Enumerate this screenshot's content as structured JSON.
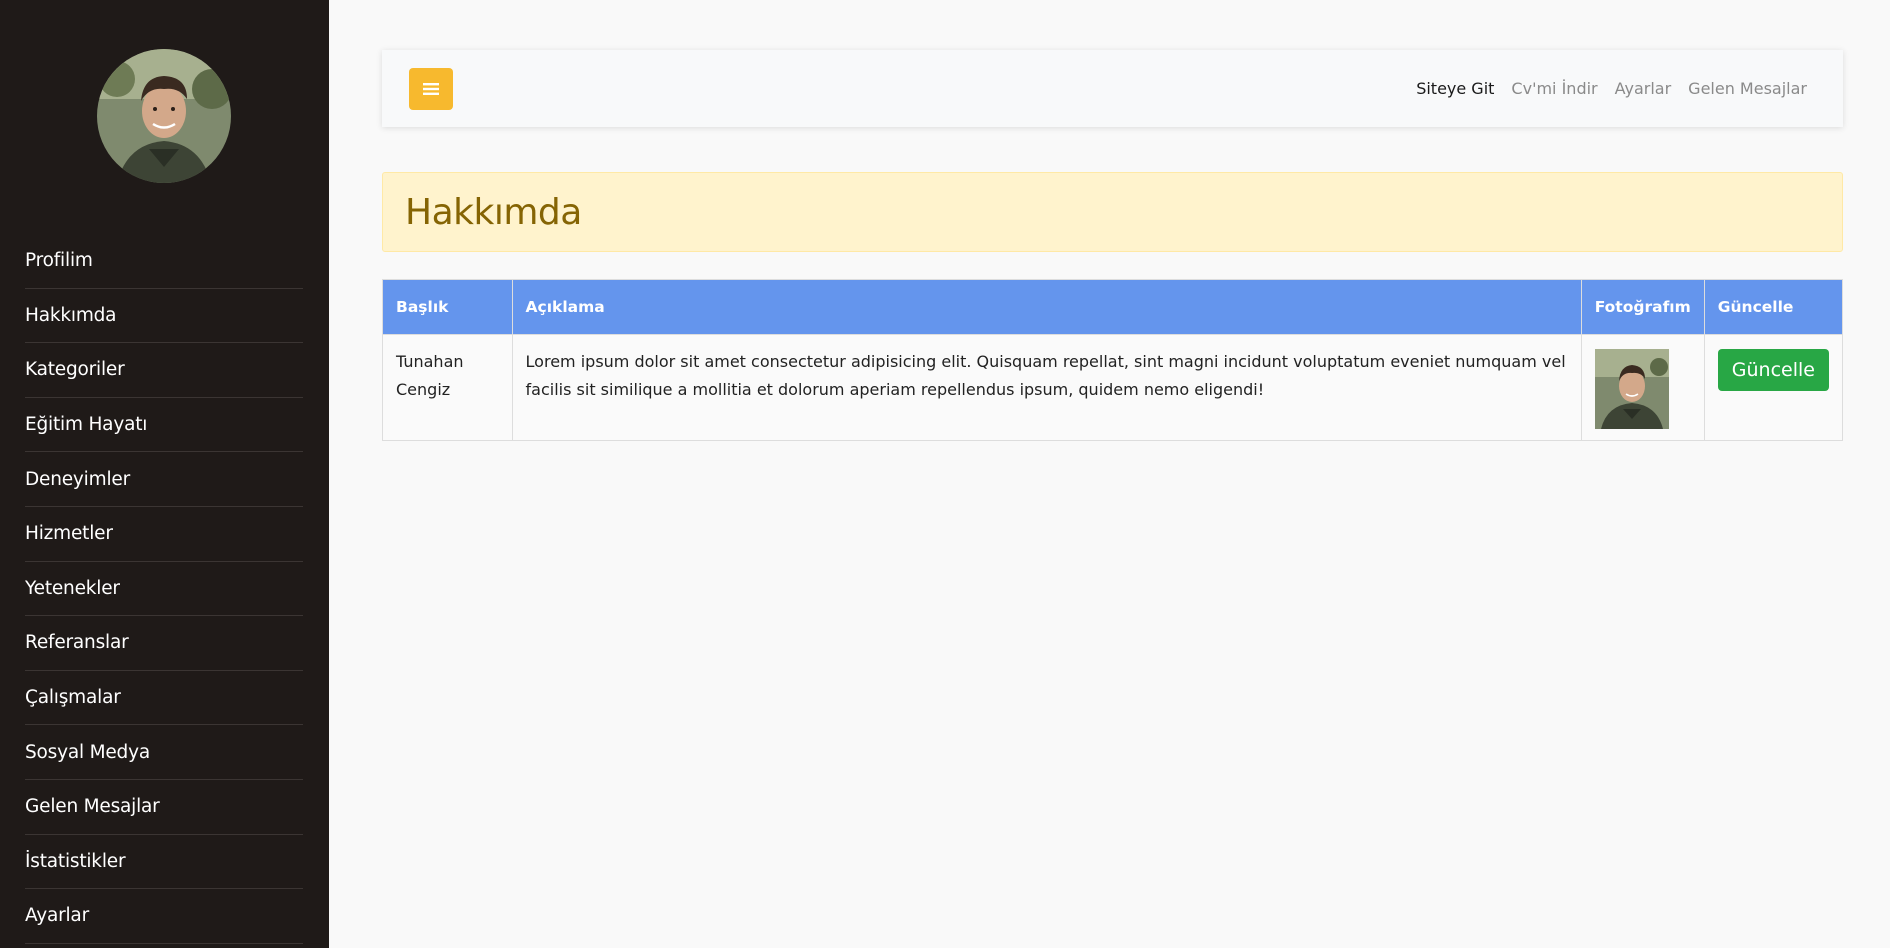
{
  "sidebar": {
    "avatar_icon": "profile-photo",
    "items": [
      {
        "label": "Profilim"
      },
      {
        "label": "Hakkımda"
      },
      {
        "label": "Kategoriler"
      },
      {
        "label": "Eğitim Hayatı"
      },
      {
        "label": "Deneyimler"
      },
      {
        "label": "Hizmetler"
      },
      {
        "label": "Yetenekler"
      },
      {
        "label": "Referanslar"
      },
      {
        "label": "Çalışmalar"
      },
      {
        "label": "Sosyal Medya"
      },
      {
        "label": "Gelen Mesajlar"
      },
      {
        "label": "İstatistikler"
      },
      {
        "label": "Ayarlar"
      }
    ]
  },
  "topbar": {
    "toggle_icon": "hamburger-menu-icon",
    "links": [
      {
        "label": "Siteye Git",
        "active": true
      },
      {
        "label": "Cv'mi İndir"
      },
      {
        "label": "Ayarlar"
      },
      {
        "label": "Gelen Mesajlar"
      }
    ]
  },
  "page": {
    "title": "Hakkımda"
  },
  "table": {
    "headers": [
      "Başlık",
      "Açıklama",
      "Fotoğrafım",
      "Güncelle"
    ],
    "rows": [
      {
        "title": "Tunahan Cengiz",
        "description": "Lorem ipsum dolor sit amet consectetur adipisicing elit. Quisquam repellat, sint magni incidunt voluptatum eveniet numquam vel facilis sit similique a mollitia et dolorum aperiam repellendus ipsum, quidem nemo eligendi!",
        "photo_icon": "profile-photo-thumbnail",
        "update_label": "Güncelle"
      }
    ]
  },
  "colors": {
    "sidebar_bg": "#1f1a18",
    "accent_yellow": "#f7b92e",
    "table_header": "#6495ed",
    "alert_bg": "#fff3cd",
    "alert_text": "#856404",
    "success": "#28a745"
  }
}
